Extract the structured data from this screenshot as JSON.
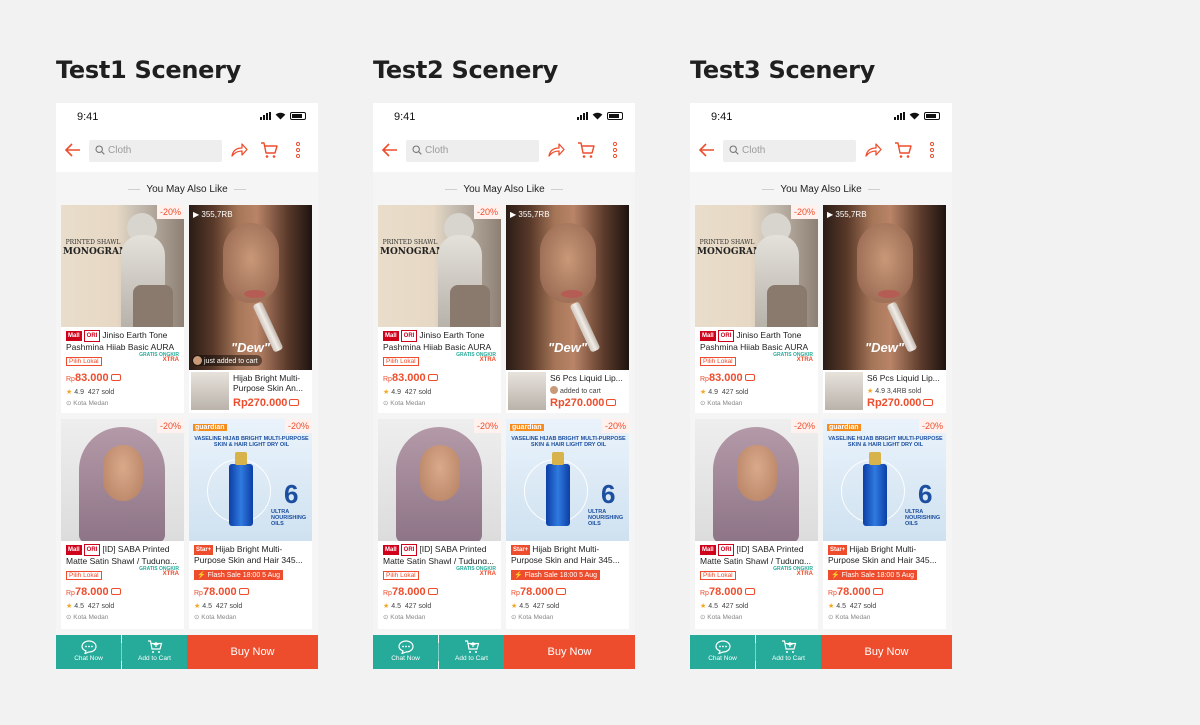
{
  "sceneries": [
    {
      "title": "Test1 Scenery",
      "variant": "toast",
      "status_time": "9:41",
      "search_placeholder": "Cloth",
      "section_title": "You May Also Like",
      "card1": {
        "discount": "-20%",
        "badge_mall": "Mall",
        "badge_ori": "ORI",
        "name": "Jiniso Earth Tone Pashmina Hijab Basic AURA",
        "lokal": "Pilih Lokal",
        "gratis": "GRATIS ONGKIR",
        "xtra": "XTRA",
        "price_cur": "Rp",
        "price": "83.000",
        "rating": "4.9",
        "sold": "427 sold",
        "location": "Kota Medan",
        "img_brand": "MONOGRAM",
        "img_sub": "PRINTED SHAWL"
      },
      "video": {
        "views": "355,7RB",
        "caption": "\"Dew\"",
        "toast": "just added to cart",
        "bottom_name": "Hijab Bright Multi-Purpose Skin An...",
        "bottom_price": "Rp270.000",
        "bottom_extra": ""
      },
      "card3": {
        "discount": "-20%",
        "badge_mall": "Mall",
        "badge_ori": "ORI",
        "name": "[ID] SABA Printed Matte Satin Shawl / Tudung...",
        "lokal": "Pilih Lokal",
        "gratis": "GRATIS ONGKIR",
        "xtra": "XTRA",
        "price_cur": "Rp",
        "price": "78.000",
        "rating": "4.5",
        "sold": "427 sold",
        "location": "Kota Medan"
      },
      "card4": {
        "discount": "-20%",
        "brand": "guardian",
        "ad_title": "VASELINE HIJAB BRIGHT MULTI-PURPOSE SKIN & HAIR LIGHT DRY OIL",
        "ad_six": "6",
        "ad_ultra": "ULTRA NOURISHING OILS",
        "badge_star": "Star+",
        "name": "Hijab Bright Multi-Purpose Skin and Hair 345...",
        "flash": "Flash Sale 18:00 5 Aug",
        "price_cur": "Rp",
        "price": "78.000",
        "rating": "4.5",
        "sold": "427 sold",
        "location": "Kota Medan"
      },
      "bottom": {
        "chat": "Chat Now",
        "add": "Add to Cart",
        "buy": "Buy Now"
      }
    },
    {
      "title": "Test2 Scenery",
      "variant": "inline",
      "status_time": "9:41",
      "search_placeholder": "Cloth",
      "section_title": "You May Also Like",
      "card1": {
        "discount": "-20%",
        "badge_mall": "Mall",
        "badge_ori": "ORI",
        "name": "Jiniso Earth Tone Pashmina Hijab Basic AURA",
        "lokal": "Pilih Lokal",
        "gratis": "GRATIS ONGKIR",
        "xtra": "XTRA",
        "price_cur": "Rp",
        "price": "83.000",
        "rating": "4.9",
        "sold": "427 sold",
        "location": "Kota Medan",
        "img_brand": "MONOGRAM",
        "img_sub": "PRINTED SHAWL"
      },
      "video": {
        "views": "355,7RB",
        "caption": "\"Dew\"",
        "toast": "",
        "bottom_name": "S6 Pcs Liquid Lip...",
        "bottom_price": "Rp270.000",
        "bottom_extra": "added to cart"
      },
      "card3": {
        "discount": "-20%",
        "badge_mall": "Mall",
        "badge_ori": "ORI",
        "name": "[ID] SABA Printed Matte Satin Shawl / Tudung...",
        "lokal": "Pilih Lokal",
        "gratis": "GRATIS ONGKIR",
        "xtra": "XTRA",
        "price_cur": "Rp",
        "price": "78.000",
        "rating": "4.5",
        "sold": "427 sold",
        "location": "Kota Medan"
      },
      "card4": {
        "discount": "-20%",
        "brand": "guardian",
        "ad_title": "VASELINE HIJAB BRIGHT MULTI-PURPOSE SKIN & HAIR LIGHT DRY OIL",
        "ad_six": "6",
        "ad_ultra": "ULTRA NOURISHING OILS",
        "badge_star": "Star+",
        "name": "Hijab Bright Multi-Purpose Skin and Hair 345...",
        "flash": "Flash Sale 18:00 5 Aug",
        "price_cur": "Rp",
        "price": "78.000",
        "rating": "4.5",
        "sold": "427 sold",
        "location": "Kota Medan"
      },
      "bottom": {
        "chat": "Chat Now",
        "add": "Add to Cart",
        "buy": "Buy Now"
      }
    },
    {
      "title": "Test3 Scenery",
      "variant": "rating",
      "status_time": "9:41",
      "search_placeholder": "Cloth",
      "section_title": "You May Also Like",
      "card1": {
        "discount": "-20%",
        "badge_mall": "Mall",
        "badge_ori": "ORI",
        "name": "Jiniso Earth Tone Pashmina Hijab Basic AURA",
        "lokal": "Pilih Lokal",
        "gratis": "GRATIS ONGKIR",
        "xtra": "XTRA",
        "price_cur": "Rp",
        "price": "83.000",
        "rating": "4.9",
        "sold": "427 sold",
        "location": "Kota Medan",
        "img_brand": "MONOGRAM",
        "img_sub": "PRINTED SHAWL"
      },
      "video": {
        "views": "355,7RB",
        "caption": "\"Dew\"",
        "toast": "",
        "bottom_name": "S6 Pcs Liquid Lip...",
        "bottom_price": "Rp270.000",
        "bottom_extra": "4.9  3,4RB sold"
      },
      "card3": {
        "discount": "-20%",
        "badge_mall": "Mall",
        "badge_ori": "ORI",
        "name": "[ID] SABA Printed Matte Satin Shawl / Tudung...",
        "lokal": "Pilih Lokal",
        "gratis": "GRATIS ONGKIR",
        "xtra": "XTRA",
        "price_cur": "Rp",
        "price": "78.000",
        "rating": "4.5",
        "sold": "427 sold",
        "location": "Kota Medan"
      },
      "card4": {
        "discount": "-20%",
        "brand": "guardian",
        "ad_title": "VASELINE HIJAB BRIGHT MULTI-PURPOSE SKIN & HAIR LIGHT DRY OIL",
        "ad_six": "6",
        "ad_ultra": "ULTRA NOURISHING OILS",
        "badge_star": "Star+",
        "name": "Hijab Bright Multi-Purpose Skin and Hair 345...",
        "flash": "Flash Sale 18:00 5 Aug",
        "price_cur": "Rp",
        "price": "78.000",
        "rating": "4.5",
        "sold": "427 sold",
        "location": "Kota Medan"
      },
      "bottom": {
        "chat": "Chat Now",
        "add": "Add to Cart",
        "buy": "Buy Now"
      }
    }
  ],
  "colors": {
    "accent": "#ee4d2d",
    "teal": "#26aa99",
    "mall_red": "#d0011b"
  }
}
